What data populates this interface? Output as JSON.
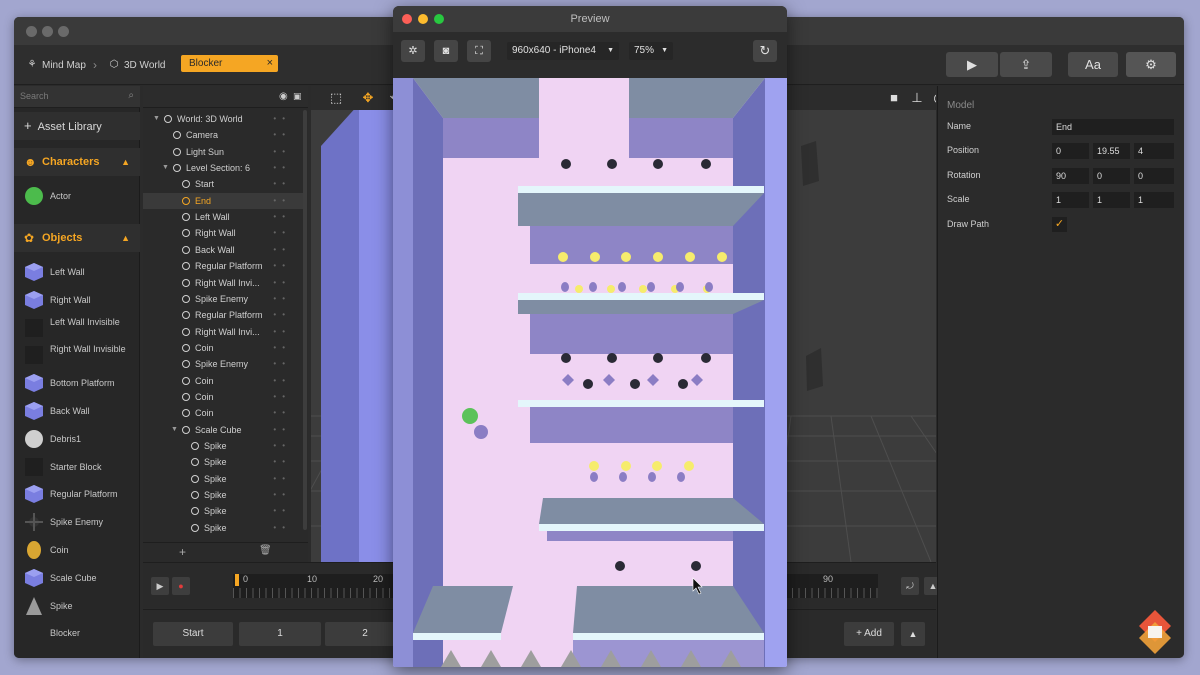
{
  "breadcrumb": {
    "items": [
      "Mind Map",
      "3D World"
    ],
    "active": "Blocker",
    "close": "×"
  },
  "toolbar": {
    "play": "▶",
    "share": "⇪",
    "font": "Aa",
    "settings": "⚙"
  },
  "asset_panel": {
    "search_placeholder": "Search",
    "library_label": "Asset Library",
    "characters_label": "Characters",
    "objects_label": "Objects",
    "characters": [
      {
        "label": "Actor",
        "icon": "actor-icon"
      }
    ],
    "objects": [
      {
        "label": "Left Wall",
        "icon": "cube-icon"
      },
      {
        "label": "Right Wall",
        "icon": "cube-icon"
      },
      {
        "label": "Left Wall Invisible",
        "icon": "invisible-cube-icon"
      },
      {
        "label": "Right Wall Invisible",
        "icon": "invisible-cube-icon"
      },
      {
        "label": "Bottom Platform",
        "icon": "cube-icon"
      },
      {
        "label": "Back Wall",
        "icon": "cube-icon"
      },
      {
        "label": "Debris1",
        "icon": "sphere-icon"
      },
      {
        "label": "Starter Block",
        "icon": "block-icon"
      },
      {
        "label": "Regular Platform",
        "icon": "cube-icon"
      },
      {
        "label": "Spike Enemy",
        "icon": "spike-enemy-icon"
      },
      {
        "label": "Coin",
        "icon": "coin-icon"
      },
      {
        "label": "Scale Cube",
        "icon": "cube-icon"
      },
      {
        "label": "Spike",
        "icon": "cone-icon"
      },
      {
        "label": "Blocker",
        "icon": "none"
      }
    ]
  },
  "hierarchy": {
    "rows": [
      {
        "label": "World: 3D World",
        "depth": 0,
        "arrow": "▼",
        "icon": "globe"
      },
      {
        "label": "Camera",
        "depth": 1,
        "icon": "camera"
      },
      {
        "label": "Light Sun",
        "depth": 1,
        "icon": "node"
      },
      {
        "label": "Level Section: 6",
        "depth": 1,
        "arrow": "▼",
        "icon": "section"
      },
      {
        "label": "Start",
        "depth": 2,
        "icon": "node"
      },
      {
        "label": "End",
        "depth": 2,
        "icon": "node",
        "selected": true
      },
      {
        "label": "Left Wall",
        "depth": 2,
        "icon": "node"
      },
      {
        "label": "Right Wall",
        "depth": 2,
        "icon": "node"
      },
      {
        "label": "Back Wall",
        "depth": 2,
        "icon": "node"
      },
      {
        "label": "Regular Platform",
        "depth": 2,
        "icon": "node"
      },
      {
        "label": "Right Wall Invi...",
        "depth": 2,
        "icon": "node"
      },
      {
        "label": "Spike Enemy",
        "depth": 2,
        "icon": "node"
      },
      {
        "label": "Regular Platform",
        "depth": 2,
        "icon": "node"
      },
      {
        "label": "Right Wall Invi...",
        "depth": 2,
        "icon": "node"
      },
      {
        "label": "Coin",
        "depth": 2,
        "icon": "node"
      },
      {
        "label": "Spike Enemy",
        "depth": 2,
        "icon": "node"
      },
      {
        "label": "Coin",
        "depth": 2,
        "icon": "node"
      },
      {
        "label": "Coin",
        "depth": 2,
        "icon": "node"
      },
      {
        "label": "Coin",
        "depth": 2,
        "icon": "node"
      },
      {
        "label": "Scale Cube",
        "depth": 2,
        "arrow": "▼",
        "icon": "node"
      },
      {
        "label": "Spike",
        "depth": 3,
        "icon": "node"
      },
      {
        "label": "Spike",
        "depth": 3,
        "icon": "node"
      },
      {
        "label": "Spike",
        "depth": 3,
        "icon": "node"
      },
      {
        "label": "Spike",
        "depth": 3,
        "icon": "node"
      },
      {
        "label": "Spike",
        "depth": 3,
        "icon": "node"
      },
      {
        "label": "Spike",
        "depth": 3,
        "icon": "node"
      }
    ],
    "add": "+",
    "delete": "🗑"
  },
  "timeline": {
    "ticks": [
      "0",
      "10",
      "20",
      "90"
    ],
    "play": "▶",
    "record": "●"
  },
  "bottom": {
    "buttons": [
      "Start",
      "1",
      "2"
    ],
    "add_label": "+ Add",
    "up": "▲"
  },
  "inspector": {
    "title": "Model",
    "name_label": "Name",
    "name_value": "End",
    "position_label": "Position",
    "position": [
      "0",
      "19.55",
      "4"
    ],
    "rotation_label": "Rotation",
    "rotation": [
      "90",
      "0",
      "0"
    ],
    "scale_label": "Scale",
    "scale": [
      "1",
      "1",
      "1"
    ],
    "draw_path_label": "Draw Path",
    "draw_path_checked": "✓"
  },
  "preview": {
    "title": "Preview",
    "device": "960x640 - iPhone4",
    "zoom": "75%"
  },
  "colors": {
    "accent": "#f5a623",
    "game_bg": "#f0d3f2",
    "wall": "#8d8fd6",
    "platform": "#7f8da3",
    "coin": "#f6ec6c"
  }
}
